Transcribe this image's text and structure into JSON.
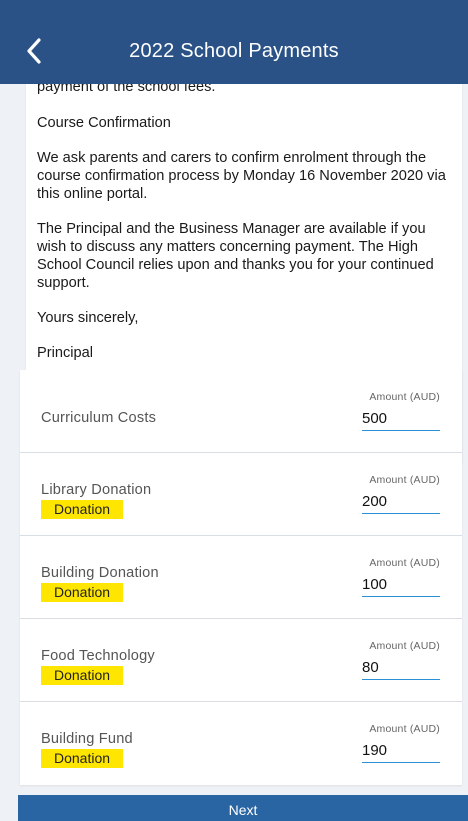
{
  "header": {
    "title": "2022 School Payments"
  },
  "letter": {
    "cut_line": "payment of the school fees.",
    "heading": "Course Confirmation",
    "para1": "We ask parents and carers to confirm enrolment through the course confirmation process by Monday 16 November 2020 via this online portal.",
    "para2": "The Principal and the Business Manager are available if you wish to discuss any matters concerning payment. The High School Council relies upon and thanks you for your continued support.",
    "signoff": "Yours sincerely,",
    "signature": "Principal"
  },
  "fees": {
    "amount_caption": "Amount (AUD)",
    "items": [
      {
        "label": "Curriculum Costs",
        "badge": "",
        "amount": "500"
      },
      {
        "label": "Library Donation",
        "badge": "Donation",
        "amount": "200"
      },
      {
        "label": "Building Donation",
        "badge": "Donation",
        "amount": "100"
      },
      {
        "label": "Food Technology",
        "badge": "Donation",
        "amount": "80"
      },
      {
        "label": "Building Fund",
        "badge": "Donation",
        "amount": "190"
      }
    ]
  },
  "footer": {
    "next_label": "Next"
  },
  "colors": {
    "header_bg": "#2b5286",
    "badge_bg": "#ffe600",
    "field_underline": "#2a8fd4",
    "next_bg": "#2a65a3"
  }
}
